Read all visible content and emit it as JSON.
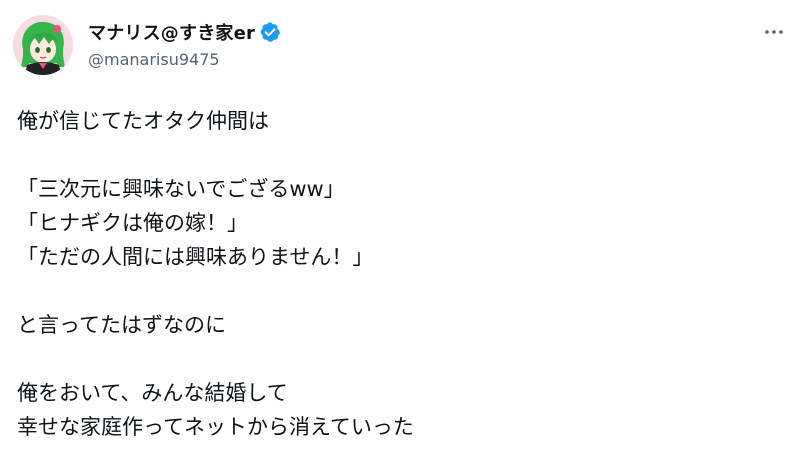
{
  "author": {
    "display_name": "マナリス@すき家er",
    "handle": "@manarisu9475",
    "verified": true,
    "verified_color": "#1d9bf0",
    "avatar_icon": "anime-character-avatar"
  },
  "menu": {
    "more_icon": "more-horizontal-icon",
    "more_label": "···"
  },
  "tweet": {
    "lines": [
      "俺が信じてたオタク仲間は",
      "",
      "「三次元に興味ないでござるww」",
      "「ヒナギクは俺の嫁！」",
      "「ただの人間には興味ありません！」",
      "",
      "と言ってたはずなのに",
      "",
      "俺をおいて、みんな結婚して",
      "幸せな家庭作ってネットから消えていった"
    ]
  }
}
